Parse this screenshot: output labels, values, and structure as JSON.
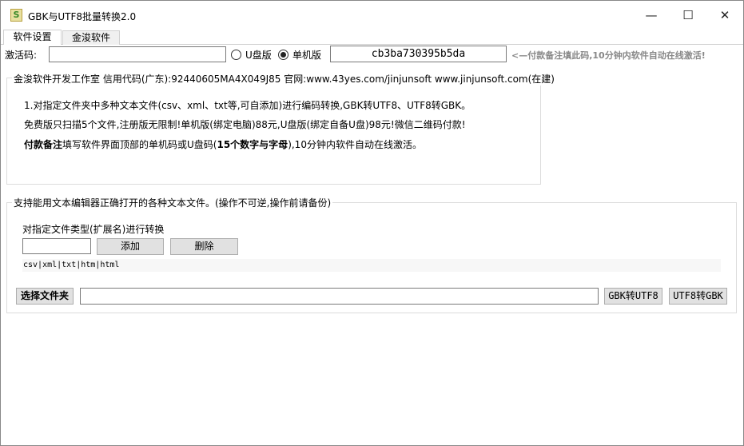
{
  "window": {
    "title": "GBK与UTF8批量转换2.0",
    "icon_text": "S",
    "minimize": "—",
    "maximize": "☐",
    "close": "✕"
  },
  "tabs": [
    {
      "label": "软件设置"
    },
    {
      "label": "金浚软件"
    }
  ],
  "activation": {
    "label": "激活码:",
    "value": "",
    "radio_usb": "U盘版",
    "radio_standalone": "单机版",
    "selected": "单机版",
    "machine_code": "cb3ba730395b5da",
    "hint": "<—付款备注填此码,10分钟内软件自动在线激活!"
  },
  "info_group": {
    "legend": "金浚软件开发工作室 信用代码(广东):92440605MA4X049J85 官网:www.43yes.com/jinjunsoft  www.jinjunsoft.com(在建)",
    "line1": "1.对指定文件夹中多种文本文件(csv、xml、txt等,可自添加)进行编码转换,GBK转UTF8、UTF8转GBK。",
    "line2": "免费版只扫描5个文件,注册版无限制!单机版(绑定电脑)88元,U盘版(绑定自备U盘)98元!微信二维码付款!",
    "line3_bold": "付款备注",
    "line3_rest": "填写软件界面顶部的单机码或U盘码(",
    "line3_bold2": "15个数字与字母",
    "line3_end": "),10分钟内软件自动在线激活。"
  },
  "convert_group": {
    "legend": "支持能用文本编辑器正确打开的各种文本文件。(操作不可逆,操作前请备份)",
    "ext_label": "对指定文件类型(扩展名)进行转换",
    "ext_value": "",
    "add": "添加",
    "delete": "删除",
    "ext_list": "csv|xml|txt|htm|html",
    "choose_folder": "选择文件夹",
    "folder_path": "",
    "gbk_to_utf8": "GBK转UTF8",
    "utf8_to_gbk": "UTF8转GBK"
  }
}
